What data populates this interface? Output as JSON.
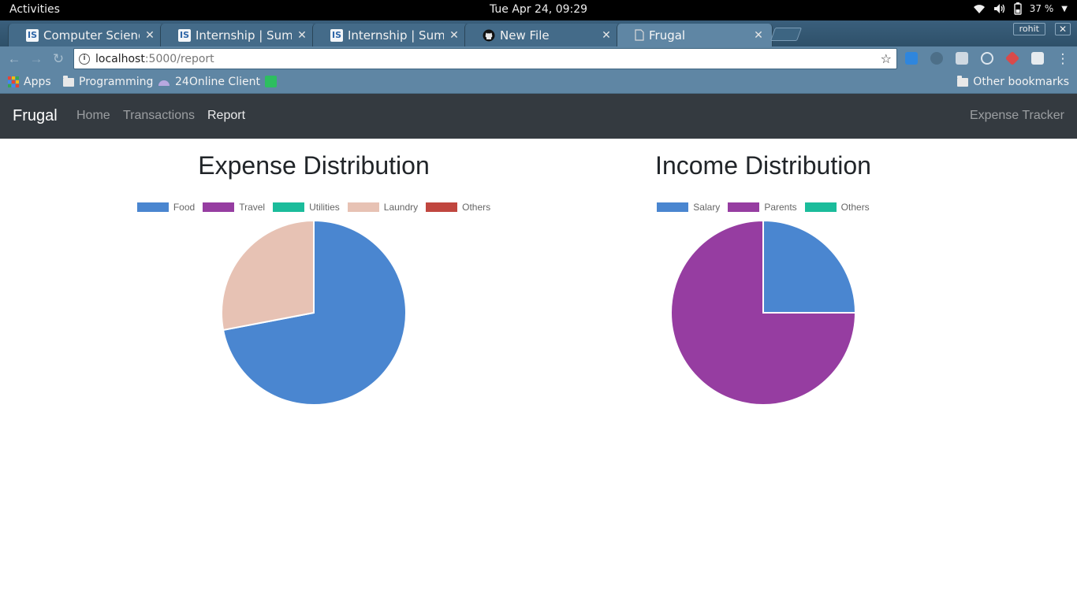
{
  "system": {
    "activities": "Activities",
    "clock": "Tue Apr 24, 09:29",
    "battery": "37 %"
  },
  "browser": {
    "tabs": [
      {
        "title": "Computer Science In",
        "icon": "is-icon"
      },
      {
        "title": "Internship | Summer",
        "icon": "is-icon"
      },
      {
        "title": "Internship | Summer",
        "icon": "is-icon"
      },
      {
        "title": "New File",
        "icon": "github-icon"
      },
      {
        "title": "Frugal",
        "icon": "page-icon"
      }
    ],
    "active_tab": 4,
    "profile": "rohit",
    "url_host": "localhost",
    "url_rest": ":5000/report",
    "bookmarks": [
      "Apps",
      "Programming",
      "24Online Client"
    ],
    "other_bookmarks": "Other bookmarks"
  },
  "navbar": {
    "brand": "Frugal",
    "links": [
      "Home",
      "Transactions",
      "Report"
    ],
    "active_link": "Report",
    "right": "Expense Tracker"
  },
  "colors": {
    "blue": "#4a86d0",
    "purple": "#963da1",
    "teal": "#1bbc9b",
    "peach": "#e7c2b4",
    "red": "#c0463f"
  },
  "chart_data": [
    {
      "type": "pie",
      "title": "Expense Distribution",
      "labels": [
        "Food",
        "Travel",
        "Utilities",
        "Laundry",
        "Others"
      ],
      "values": [
        72,
        0,
        0,
        28,
        0
      ],
      "colors": [
        "#4a86d0",
        "#963da1",
        "#1bbc9b",
        "#e7c2b4",
        "#c0463f"
      ],
      "legend": "top"
    },
    {
      "type": "pie",
      "title": "Income Distribution",
      "labels": [
        "Salary",
        "Parents",
        "Others"
      ],
      "values": [
        25,
        75,
        0
      ],
      "colors": [
        "#4a86d0",
        "#963da1",
        "#1bbc9b"
      ],
      "legend": "top"
    }
  ]
}
